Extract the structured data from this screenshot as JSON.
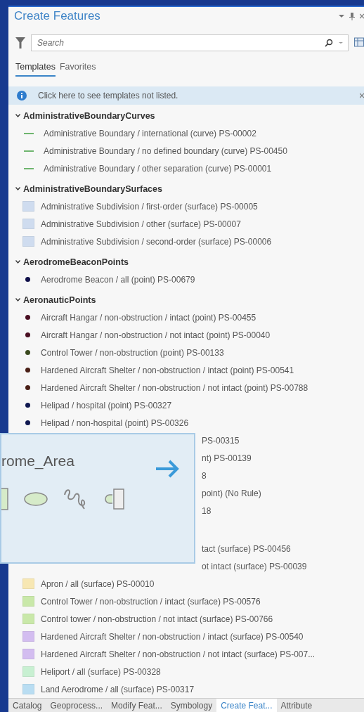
{
  "panel": {
    "title": "Create Features"
  },
  "search": {
    "placeholder": "Search"
  },
  "tabs": [
    {
      "label": "Templates",
      "selected": true
    },
    {
      "label": "Favorites",
      "selected": false
    }
  ],
  "banner": {
    "text": "Click here to see templates not listed."
  },
  "groups": [
    {
      "name": "AdministrativeBoundaryCurves",
      "expanded": true,
      "children": [
        {
          "kind": "line",
          "color": "#6fb56f",
          "label": "Administrative Boundary / international (curve) PS-00002"
        },
        {
          "kind": "line",
          "color": "#6fb56f",
          "label": "Administrative Boundary / no defined boundary (curve) PS-00450"
        },
        {
          "kind": "line",
          "color": "#6fb56f",
          "label": "Administrative Boundary / other separation (curve) PS-00001"
        }
      ]
    },
    {
      "name": "AdministrativeBoundarySurfaces",
      "expanded": true,
      "children": [
        {
          "kind": "fill",
          "color": "#cfdcef",
          "label": "Administrative Subdivision / first-order (surface) PS-00005"
        },
        {
          "kind": "fill",
          "color": "#cfdcef",
          "label": "Administrative Subdivision / other (surface) PS-00007"
        },
        {
          "kind": "fill",
          "color": "#cfdcef",
          "label": "Administrative Subdivision / second-order (surface) PS-00006"
        }
      ]
    },
    {
      "name": "AerodromeBeaconPoints",
      "expanded": true,
      "children": [
        {
          "kind": "point",
          "color": "#10104a",
          "label": "Aerodrome Beacon / all (point) PS-00679"
        }
      ]
    },
    {
      "name": "AeronauticPoints",
      "expanded": true,
      "children": [
        {
          "kind": "point",
          "color": "#4a0f22",
          "label": "Aircraft Hangar / non-obstruction / intact (point) PS-00455"
        },
        {
          "kind": "point",
          "color": "#4a0f22",
          "label": "Aircraft Hangar / non-obstruction / not intact (point) PS-00040"
        },
        {
          "kind": "point",
          "color": "#3b4a1f",
          "label": "Control Tower / non-obstruction (point) PS-00133"
        },
        {
          "kind": "point",
          "color": "#4a1f16",
          "label": "Hardened Aircraft Shelter / non-obstruction / intact (point) PS-00541"
        },
        {
          "kind": "point",
          "color": "#4a1f16",
          "label": "Hardened Aircraft Shelter / non-obstruction / not intact (point) PS-00788"
        },
        {
          "kind": "point",
          "color": "#0f1850",
          "label": "Helipad / hospital (point) PS-00327"
        },
        {
          "kind": "point",
          "color": "#0f1850",
          "label": "Helipad / non-hospital (point) PS-00326"
        },
        {
          "kind": "covered",
          "label": "PS-00315"
        },
        {
          "kind": "covered",
          "label": "nt) PS-00139"
        },
        {
          "kind": "covered",
          "label": "8"
        },
        {
          "kind": "covered",
          "label": "point) (No Rule)"
        },
        {
          "kind": "covered",
          "label": "18"
        }
      ]
    },
    {
      "children": [
        {
          "kind": "covered",
          "label": "tact (surface) PS-00456"
        },
        {
          "kind": "covered",
          "label": "ot intact (surface) PS-00039"
        },
        {
          "kind": "fill",
          "color": "#f7e7b3",
          "label": "Apron / all (surface) PS-00010"
        },
        {
          "kind": "fill",
          "color": "#c9e8a9",
          "label": "Control Tower / non-obstruction / intact (surface) PS-00576"
        },
        {
          "kind": "fill",
          "color": "#c9e8a9",
          "label": "Control tower / non-obstruction / not intact (surface) PS-00766"
        },
        {
          "kind": "fill",
          "color": "#d3bdf0",
          "label": "Hardened Aircraft Shelter / non-obstruction / intact (surface) PS-00540"
        },
        {
          "kind": "fill",
          "color": "#d3bdf0",
          "label": "Hardened Aircraft Shelter / non-obstruction / not intact (surface) PS-007..."
        },
        {
          "kind": "fill",
          "color": "#c8f0d2",
          "label": "Heliport / all (surface) PS-00328"
        },
        {
          "kind": "fill",
          "color": "#b9ddf2",
          "label": "Land Aerodrome / all (surface) PS-00317"
        }
      ]
    }
  ],
  "popup": {
    "title": "rome_Area"
  },
  "bottom_tabs": [
    {
      "label": "Catalog",
      "selected": false
    },
    {
      "label": "Geoprocess...",
      "selected": false
    },
    {
      "label": "Modify Feat...",
      "selected": false
    },
    {
      "label": "Symbology",
      "selected": false
    },
    {
      "label": "Create Feat...",
      "selected": true
    },
    {
      "label": "Attribute",
      "selected": false
    }
  ]
}
